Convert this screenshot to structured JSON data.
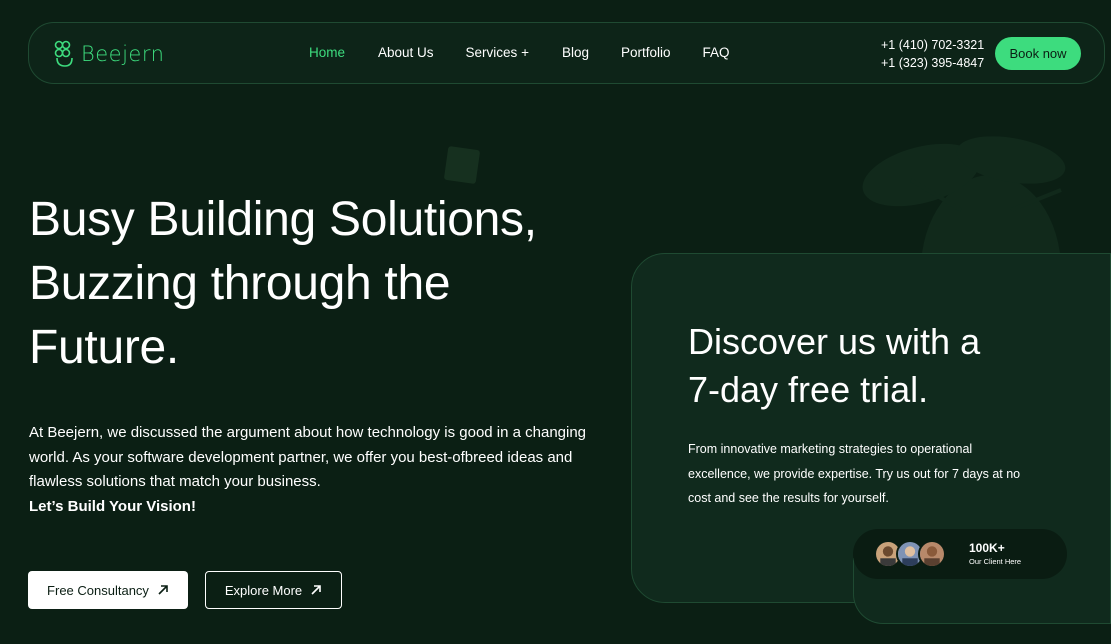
{
  "brand": {
    "logo_text": "Beejern",
    "accent": "#3ddc7e",
    "background": "#0b1f14"
  },
  "nav": {
    "items": [
      {
        "label": "Home",
        "active": true
      },
      {
        "label": "About Us",
        "active": false
      },
      {
        "label": "Services +",
        "active": false
      },
      {
        "label": "Blog",
        "active": false
      },
      {
        "label": "Portfolio",
        "active": false
      },
      {
        "label": "FAQ",
        "active": false
      }
    ],
    "phones": [
      "+1 (410) 702-3321",
      "+1 (323) 395-4847"
    ],
    "book_label": "Book now"
  },
  "hero": {
    "title_lines": [
      "Busy Building Solutions,",
      "Buzzing through the",
      "Future."
    ],
    "description": "At Beejern, we discussed the argument about how technology is good in a changing world. As your software development partner, we offer you best-ofbreed ideas and flawless solutions that match your business.",
    "cta_text": "Let’s Build Your Vision!",
    "primary_button": "Free Consultancy",
    "secondary_button": "Explore More",
    "button_icon": "arrow-up-right-icon"
  },
  "trial": {
    "title_lines": [
      "Discover us with a",
      "7-day free trial."
    ],
    "description": "From innovative marketing strategies to operational excellence, we provide expertise. Try us out for 7 days at no cost and see the results for yourself.",
    "clients_count": "100K+",
    "clients_label": "Our Client Here"
  }
}
